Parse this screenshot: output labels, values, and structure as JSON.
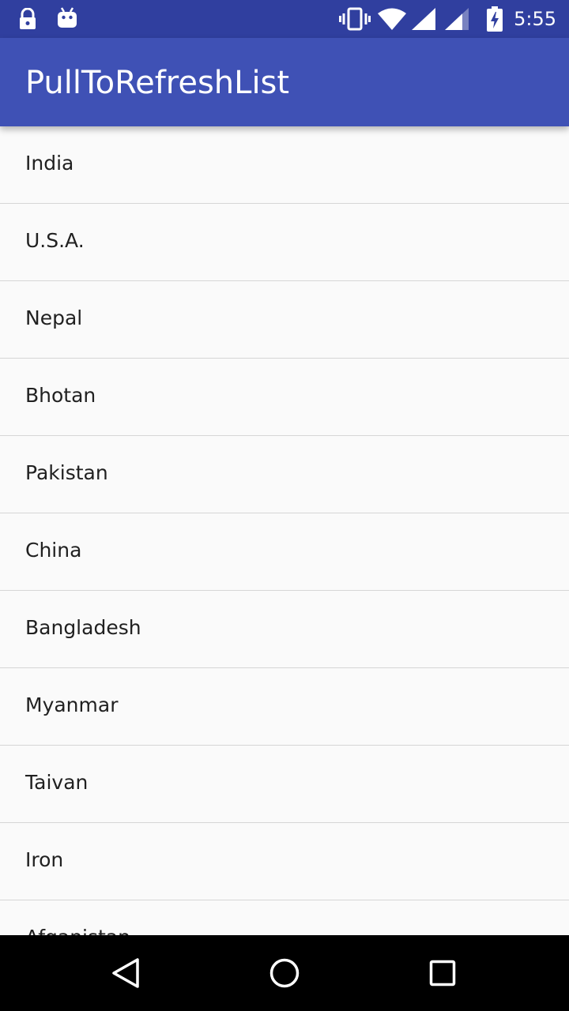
{
  "status_bar": {
    "time": "5:55",
    "left_icons": [
      "lock-icon",
      "android-debug-icon"
    ],
    "right_icons": [
      "vibrate-icon",
      "wifi-icon",
      "cell-signal-icon",
      "cell-signal-2-icon",
      "battery-charging-icon"
    ]
  },
  "app_bar": {
    "title": "PullToRefreshList"
  },
  "list": {
    "items": [
      {
        "label": "India"
      },
      {
        "label": "U.S.A."
      },
      {
        "label": "Nepal"
      },
      {
        "label": "Bhotan"
      },
      {
        "label": "Pakistan"
      },
      {
        "label": "China"
      },
      {
        "label": "Bangladesh"
      },
      {
        "label": "Myanmar"
      },
      {
        "label": "Taivan"
      },
      {
        "label": "Iron"
      },
      {
        "label": "Afganistan"
      }
    ]
  },
  "nav_bar": {
    "buttons": [
      "back-icon",
      "home-icon",
      "recents-icon"
    ]
  },
  "colors": {
    "status_bar": "#303f9f",
    "app_bar": "#3f51b5",
    "background": "#fafafa",
    "divider": "#d6d6d6",
    "nav_bar": "#000000"
  }
}
